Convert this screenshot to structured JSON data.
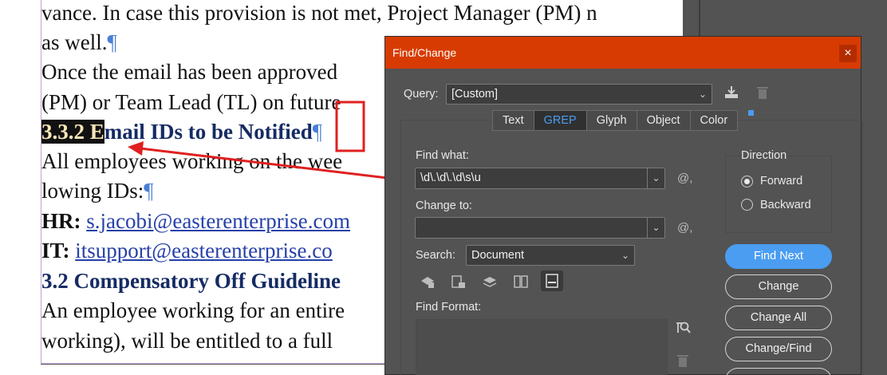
{
  "document": {
    "lines": [
      {
        "text": "vance. In case this provision is not met, Project Manager (PM) n"
      },
      {
        "text": "as well.",
        "pilcrow": "¶"
      },
      {
        "text": "Once the email has been approved"
      },
      {
        "text": "(PM) or Team Lead (TL) on future"
      },
      {
        "hl": "3.3.2 E",
        "rest": "mail IDs to be Notified",
        "pilcrow": "¶"
      },
      {
        "text": "All employees working on the wee"
      },
      {
        "text": "lowing IDs:",
        "pilcrow": "¶"
      },
      {
        "label": "HR: ",
        "link": "s.jacobi@easterenterprise.com"
      },
      {
        "label": "IT: ",
        "link": "itsupport@easterenterprise.co"
      },
      {
        "text": "3.2 Compensatory Off Guideline"
      },
      {
        "text": "An employee working for an entire"
      },
      {
        "text": "working), will be entitled to a full"
      }
    ]
  },
  "dialog": {
    "title": "Find/Change",
    "close": "×",
    "query_label": "Query:",
    "query_value": "[Custom]",
    "tabs": [
      {
        "label": "Text",
        "active": false
      },
      {
        "label": "GREP",
        "active": true
      },
      {
        "label": "Glyph",
        "active": false
      },
      {
        "label": "Object",
        "active": false
      },
      {
        "label": "Color",
        "active": false
      }
    ],
    "find_what_label": "Find what:",
    "find_what_value": "\\d\\.\\d\\.\\d\\s\\u",
    "change_to_label": "Change to:",
    "change_to_value": "",
    "special_char": "@,",
    "search_label": "Search:",
    "search_value": "Document",
    "find_format_label": "Find Format:",
    "direction_label": "Direction",
    "direction_forward": "Forward",
    "direction_backward": "Backward",
    "direction_selected": "Forward",
    "buttons": {
      "find_next": "Find Next",
      "change": "Change",
      "change_all": "Change All",
      "change_find": "Change/Find"
    }
  },
  "colors": {
    "titlebar": "#d83b01",
    "accent": "#4a9df1",
    "annotation": "#e02020"
  }
}
